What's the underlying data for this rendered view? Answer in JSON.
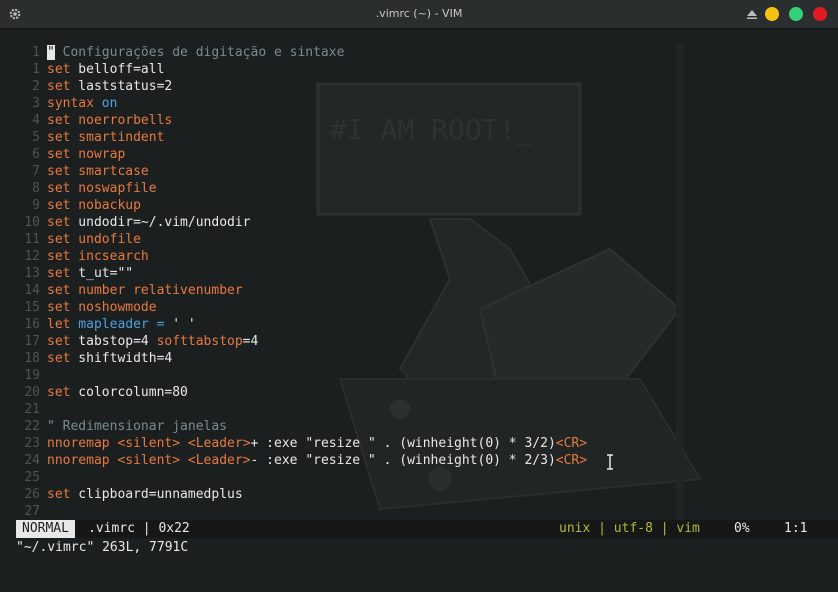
{
  "window": {
    "title": ".vimrc (~) - VIM"
  },
  "editor": {
    "lines": [
      {
        "num": "1",
        "segments": [
          {
            "t": "\"",
            "c": "cursor-block"
          },
          {
            "t": " Configurações de digitação e sintaxe",
            "c": "cmt"
          }
        ]
      },
      {
        "num": "1",
        "segments": [
          {
            "t": "set",
            "c": "kw"
          },
          {
            "t": " belloff=all",
            "c": "str"
          }
        ]
      },
      {
        "num": "2",
        "segments": [
          {
            "t": "set",
            "c": "kw"
          },
          {
            "t": " laststatus=2",
            "c": "str"
          }
        ]
      },
      {
        "num": "3",
        "segments": [
          {
            "t": "syntax",
            "c": "kw"
          },
          {
            "t": " on",
            "c": "blue"
          }
        ]
      },
      {
        "num": "4",
        "segments": [
          {
            "t": "set",
            "c": "kw"
          },
          {
            "t": " noerrorbells",
            "c": "kw"
          }
        ]
      },
      {
        "num": "5",
        "segments": [
          {
            "t": "set",
            "c": "kw"
          },
          {
            "t": " smartindent",
            "c": "kw"
          }
        ]
      },
      {
        "num": "6",
        "segments": [
          {
            "t": "set",
            "c": "kw"
          },
          {
            "t": " nowrap",
            "c": "kw"
          }
        ]
      },
      {
        "num": "7",
        "segments": [
          {
            "t": "set",
            "c": "kw"
          },
          {
            "t": " smartcase",
            "c": "kw"
          }
        ]
      },
      {
        "num": "8",
        "segments": [
          {
            "t": "set",
            "c": "kw"
          },
          {
            "t": " noswapfile",
            "c": "kw"
          }
        ]
      },
      {
        "num": "9",
        "segments": [
          {
            "t": "set",
            "c": "kw"
          },
          {
            "t": " nobackup",
            "c": "kw"
          }
        ]
      },
      {
        "num": "10",
        "segments": [
          {
            "t": "set",
            "c": "kw"
          },
          {
            "t": " undodir=~/.vim/undodir",
            "c": "str"
          }
        ]
      },
      {
        "num": "11",
        "segments": [
          {
            "t": "set",
            "c": "kw"
          },
          {
            "t": " undofile",
            "c": "kw"
          }
        ]
      },
      {
        "num": "12",
        "segments": [
          {
            "t": "set",
            "c": "kw"
          },
          {
            "t": " incsearch",
            "c": "kw"
          }
        ]
      },
      {
        "num": "13",
        "segments": [
          {
            "t": "set",
            "c": "kw"
          },
          {
            "t": " t_ut=\"\"",
            "c": "str"
          }
        ]
      },
      {
        "num": "14",
        "segments": [
          {
            "t": "set",
            "c": "kw"
          },
          {
            "t": " number relativenumber",
            "c": "kw"
          }
        ]
      },
      {
        "num": "15",
        "segments": [
          {
            "t": "set",
            "c": "kw"
          },
          {
            "t": " noshowmode",
            "c": "kw"
          }
        ]
      },
      {
        "num": "16",
        "segments": [
          {
            "t": "let",
            "c": "kw"
          },
          {
            "t": " mapleader = ",
            "c": "blue"
          },
          {
            "t": "' '",
            "c": "str"
          }
        ]
      },
      {
        "num": "17",
        "segments": [
          {
            "t": "set",
            "c": "kw"
          },
          {
            "t": " tabstop=4 ",
            "c": "str"
          },
          {
            "t": "softtabstop",
            "c": "kw"
          },
          {
            "t": "=4",
            "c": "str"
          }
        ]
      },
      {
        "num": "18",
        "segments": [
          {
            "t": "set",
            "c": "kw"
          },
          {
            "t": " shiftwidth=4",
            "c": "str"
          }
        ]
      },
      {
        "num": "19",
        "segments": []
      },
      {
        "num": "20",
        "segments": [
          {
            "t": "set",
            "c": "kw"
          },
          {
            "t": " colorcolumn=80",
            "c": "str"
          }
        ]
      },
      {
        "num": "21",
        "segments": []
      },
      {
        "num": "22",
        "segments": [
          {
            "t": "\" Redimensionar janelas",
            "c": "cmt"
          }
        ]
      },
      {
        "num": "23",
        "segments": [
          {
            "t": "nnoremap",
            "c": "kw"
          },
          {
            "t": " ",
            "c": "str"
          },
          {
            "t": "<silent>",
            "c": "kw"
          },
          {
            "t": " ",
            "c": "str"
          },
          {
            "t": "<Leader>",
            "c": "kw"
          },
          {
            "t": "+ :exe \"resize \" . (winheight(0) * 3/2)",
            "c": "str"
          },
          {
            "t": "<CR>",
            "c": "kw"
          }
        ]
      },
      {
        "num": "24",
        "segments": [
          {
            "t": "nnoremap",
            "c": "kw"
          },
          {
            "t": " ",
            "c": "str"
          },
          {
            "t": "<silent>",
            "c": "kw"
          },
          {
            "t": " ",
            "c": "str"
          },
          {
            "t": "<Leader>",
            "c": "kw"
          },
          {
            "t": "- :exe \"resize \" . (winheight(0) * 2/3)",
            "c": "str"
          },
          {
            "t": "<CR>",
            "c": "kw"
          }
        ]
      },
      {
        "num": "25",
        "segments": []
      },
      {
        "num": "26",
        "segments": [
          {
            "t": "set",
            "c": "kw"
          },
          {
            "t": " clipboard=unnamedplus",
            "c": "str"
          }
        ]
      },
      {
        "num": "27",
        "segments": []
      }
    ],
    "background_text": "#I AM ROOT!_"
  },
  "statusline": {
    "mode": "NORMAL",
    "file": ".vimrc | 0x22",
    "info": "unix | utf-8 | vim",
    "percent": "0%",
    "position": "1:1"
  },
  "message": "\"~/.vimrc\" 263L, 7791C",
  "colors": {
    "keyword": "#e8793e",
    "blue": "#4aa3df",
    "comment": "#7b8a8f",
    "status_info": "#b5b83a"
  }
}
